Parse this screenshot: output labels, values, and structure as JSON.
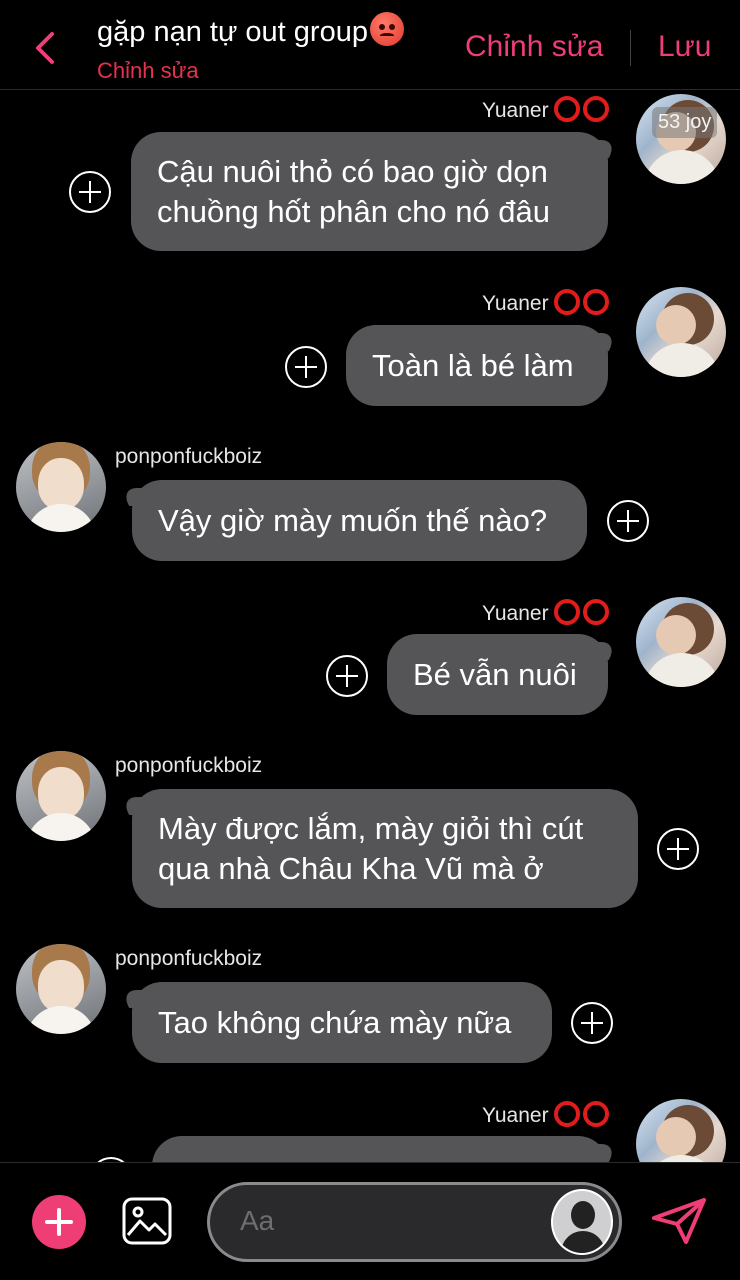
{
  "header": {
    "title": "gặp nạn tự out group",
    "title_emoji": "angry-face",
    "subtitle": "Chỉnh sửa",
    "edit_label": "Chỉnh sửa",
    "save_label": "Lưu",
    "accent": "#ef3e76"
  },
  "watermark": "53 joy",
  "messages": [
    {
      "sender": "Yuaner",
      "side": "right",
      "text_lines": [
        "Cậu nuôi thỏ có bao giờ dọn",
        "chuồng hốt phân cho nó đâu"
      ]
    },
    {
      "sender": "Yuaner",
      "side": "right",
      "text_lines": [
        "Toàn là bé làm"
      ]
    },
    {
      "sender": "ponponfuckboiz",
      "side": "left",
      "text_lines": [
        "Vậy giờ mày muốn thế nào?"
      ]
    },
    {
      "sender": "Yuaner",
      "side": "right",
      "text_lines": [
        "Bé vẫn nuôi"
      ]
    },
    {
      "sender": "ponponfuckboiz",
      "side": "left",
      "text_lines": [
        "Mày được lắm, mày giỏi thì cút",
        "qua nhà Châu Kha Vũ mà ở"
      ]
    },
    {
      "sender": "ponponfuckboiz",
      "side": "left",
      "text_lines": [
        "Tao không chứa mày nữa"
      ]
    },
    {
      "sender": "Yuaner",
      "side": "right",
      "text_lines": []
    }
  ],
  "composer": {
    "placeholder": "Aa",
    "icons": [
      "plus-icon",
      "image-icon",
      "send-icon"
    ]
  }
}
